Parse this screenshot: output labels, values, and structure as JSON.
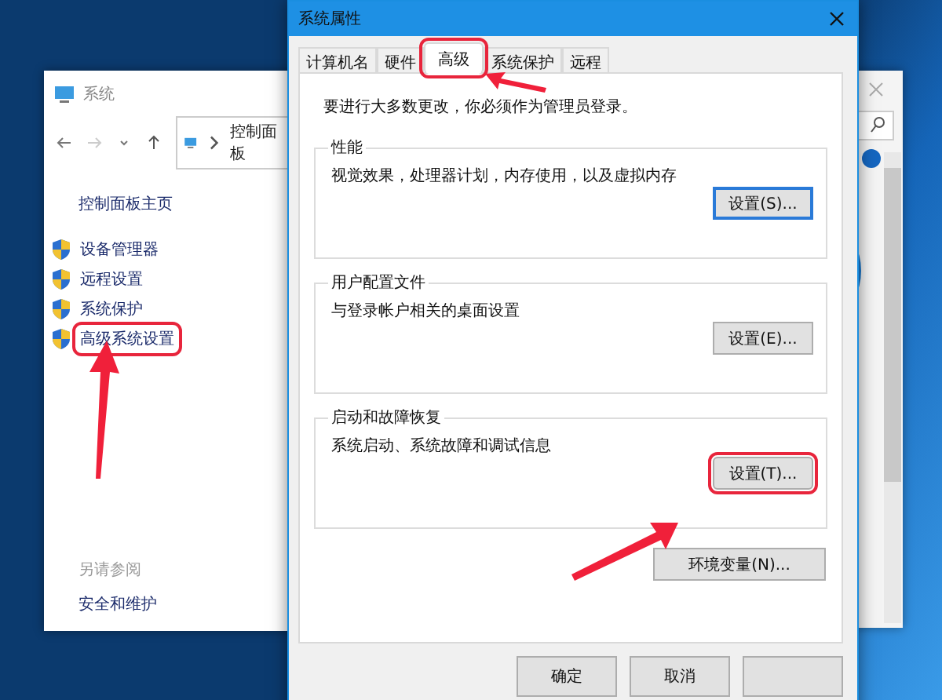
{
  "left_window": {
    "title": "系统",
    "breadcrumb": "控制面板",
    "home_link": "控制面板主页",
    "links": [
      {
        "label": "设备管理器",
        "highlighted": false
      },
      {
        "label": "远程设置",
        "highlighted": false
      },
      {
        "label": "系统保护",
        "highlighted": false
      },
      {
        "label": "高级系统设置",
        "highlighted": true
      }
    ],
    "see_also": {
      "heading": "另请参阅",
      "links": [
        "安全和维护"
      ]
    }
  },
  "dialog": {
    "title": "系统属性",
    "tabs": [
      {
        "label": "计算机名",
        "selected": false,
        "highlighted": false
      },
      {
        "label": "硬件",
        "selected": false,
        "highlighted": false
      },
      {
        "label": "高级",
        "selected": true,
        "highlighted": true
      },
      {
        "label": "系统保护",
        "selected": false,
        "highlighted": false
      },
      {
        "label": "远程",
        "selected": false,
        "highlighted": false
      }
    ],
    "notice": "要进行大多数更改，你必须作为管理员登录。",
    "groups": [
      {
        "title": "性能",
        "description": "视觉效果，处理器计划，内存使用，以及虚拟内存",
        "button": {
          "label": "设置(S)...",
          "focused": true,
          "highlighted": false
        }
      },
      {
        "title": "用户配置文件",
        "description": "与登录帐户相关的桌面设置",
        "button": {
          "label": "设置(E)...",
          "focused": false,
          "highlighted": false
        }
      },
      {
        "title": "启动和故障恢复",
        "description": "系统启动、系统故障和调试信息",
        "button": {
          "label": "设置(T)...",
          "focused": false,
          "highlighted": true
        }
      }
    ],
    "env_button": "环境变量(N)...",
    "buttons": [
      {
        "label": "确定"
      },
      {
        "label": "取消"
      }
    ]
  }
}
